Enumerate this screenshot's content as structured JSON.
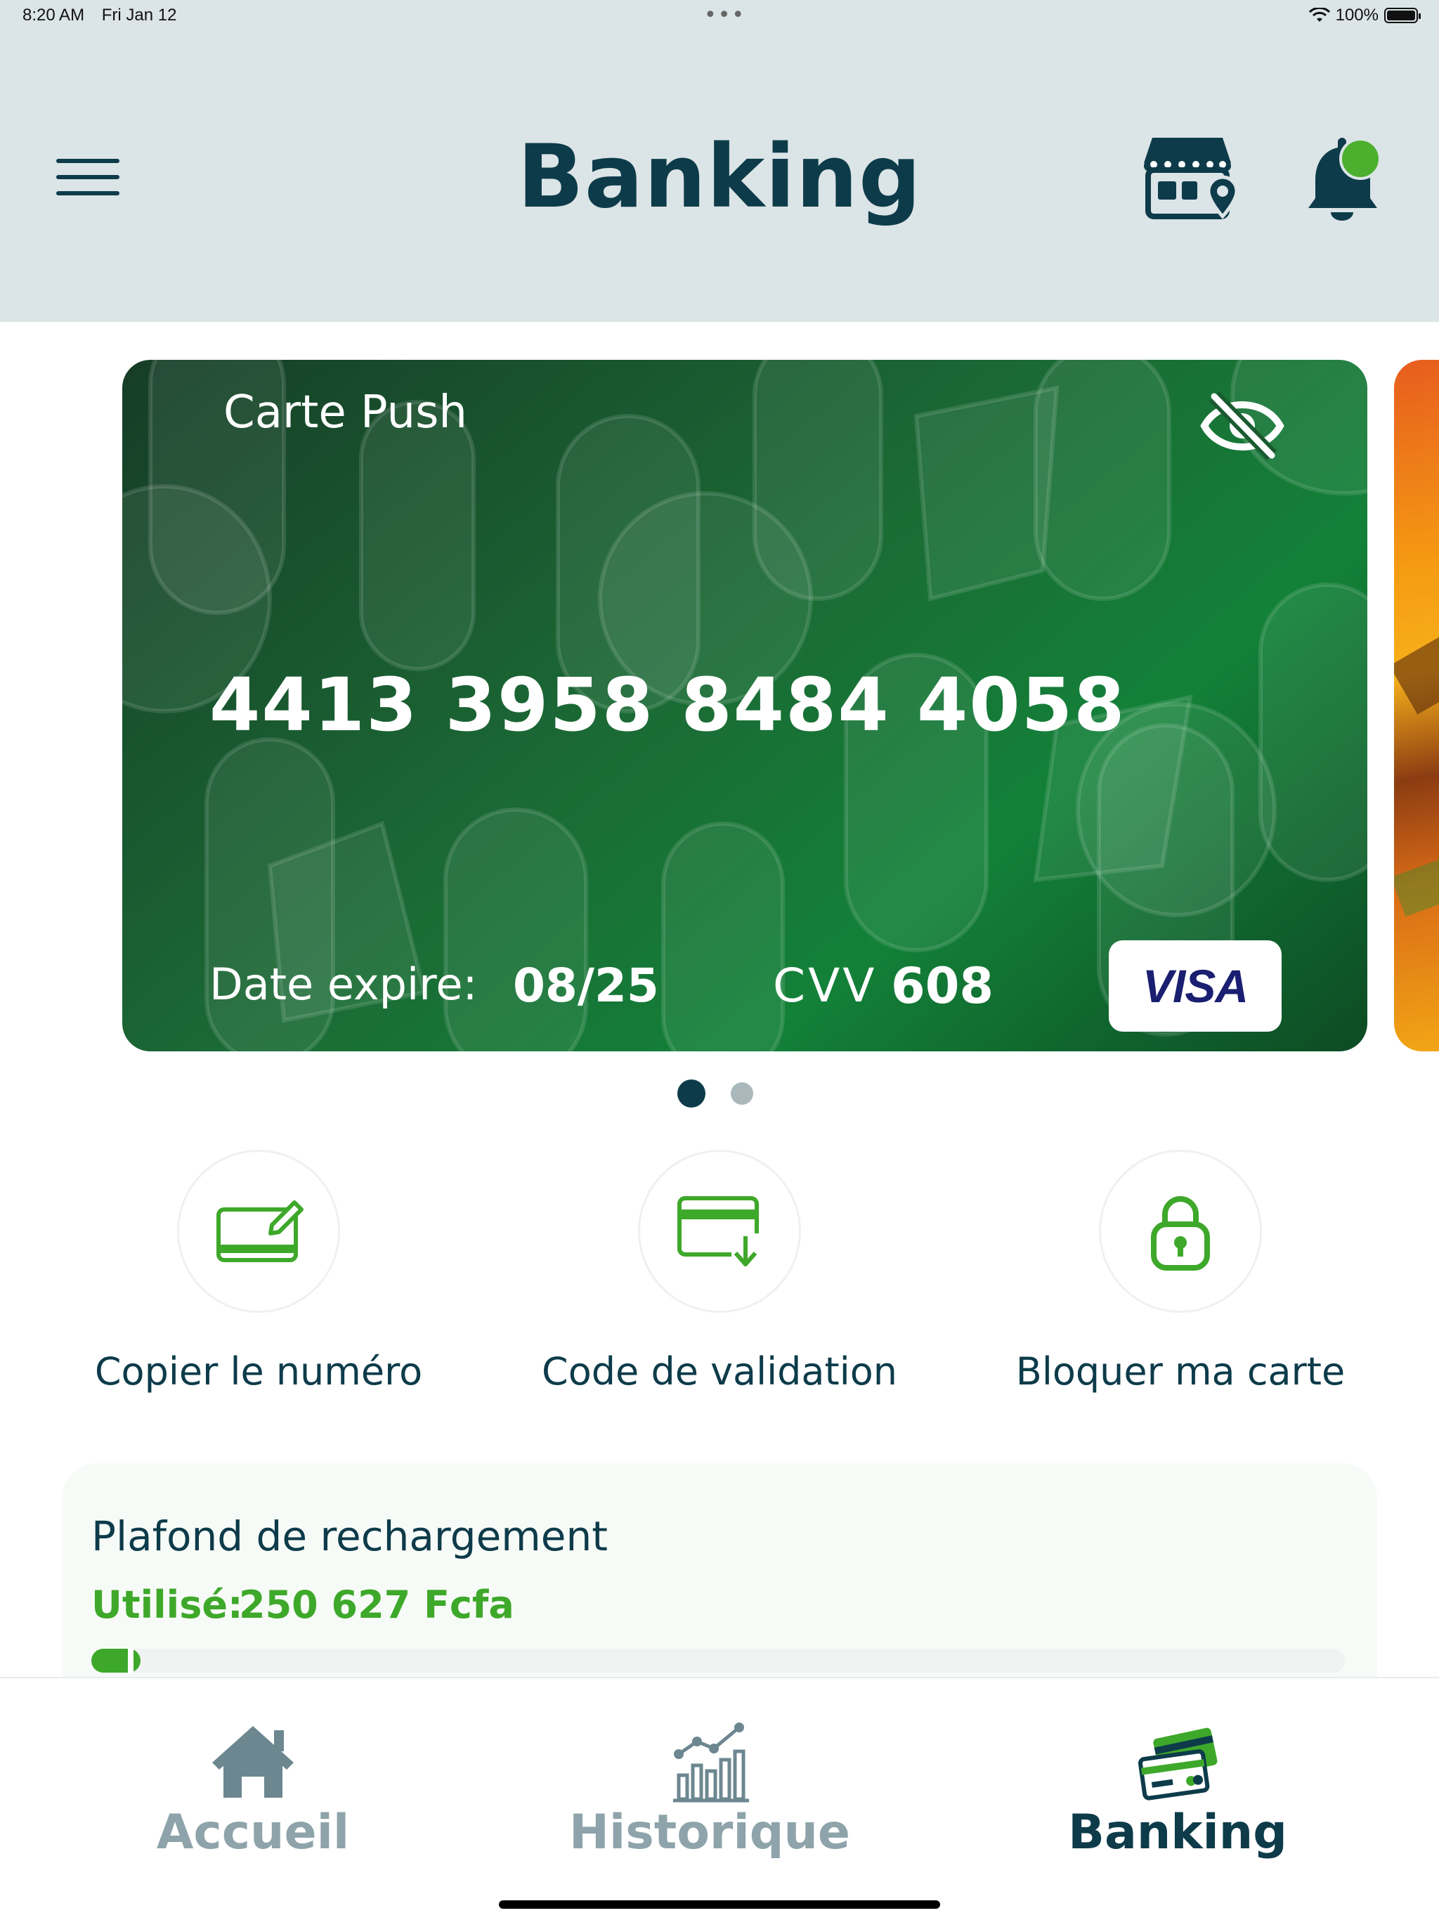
{
  "status_bar": {
    "time": "8:20 AM",
    "date": "Fri Jan 12",
    "battery": "100%"
  },
  "header": {
    "title": "Banking",
    "menu_icon": "hamburger-menu-icon",
    "store_icon": "store-locator-icon",
    "bell_icon": "bell-icon",
    "notification_dot_color": "#4caf2e"
  },
  "card": {
    "name": "Carte Push",
    "number": "4413 3958 8484 4058",
    "expiry_label": "Date expire:",
    "expiry_value": "08/25",
    "cvv_label": "CVV",
    "cvv_value": "608",
    "brand": "VISA",
    "visibility_icon": "eye-slash-icon",
    "color": "#1b6a35"
  },
  "carousel": {
    "total": 2,
    "active_index": 0
  },
  "actions": [
    {
      "label": "Copier le numéro",
      "icon": "card-edit-icon"
    },
    {
      "label": "Code de validation",
      "icon": "card-download-icon"
    },
    {
      "label": "Bloquer ma carte",
      "icon": "lock-icon"
    }
  ],
  "plafond": {
    "title": "Plafond de rechargement",
    "used_label": "Utilisé:",
    "used_value": "250 627 Fcfa",
    "progress_fraction": 0.02
  },
  "tabs": [
    {
      "label": "Accueil",
      "icon": "home-icon",
      "active": false
    },
    {
      "label": "Historique",
      "icon": "chart-icon",
      "active": false
    },
    {
      "label": "Banking",
      "icon": "cards-icon",
      "active": true
    }
  ],
  "colors": {
    "primary_dark": "#0d3b4a",
    "accent_green": "#3ea82a",
    "inactive_tab": "#8ea3aa",
    "header_bg": "#dbe4e6"
  }
}
